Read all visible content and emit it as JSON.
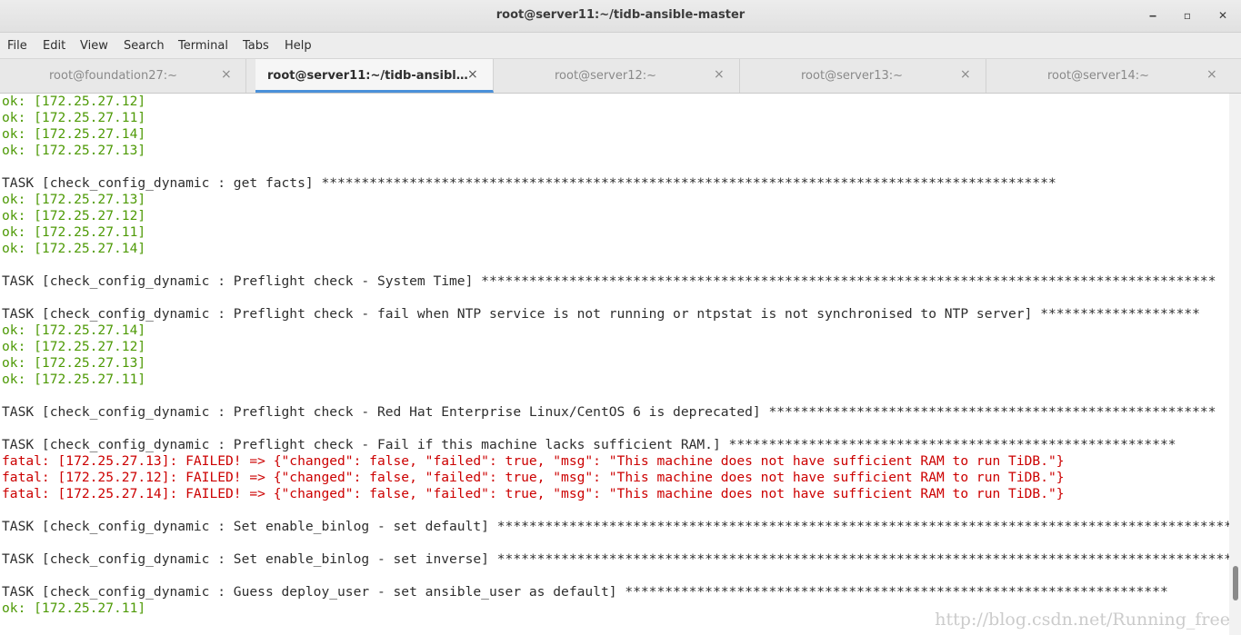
{
  "window": {
    "title": "root@server11:~/tidb-ansible-master",
    "minimize_icon": "minimize-icon",
    "maximize_icon": "maximize-icon",
    "close_icon": "close-icon",
    "minimize_glyph": "‒",
    "maximize_glyph": "▫",
    "close_glyph": "✕"
  },
  "menu": {
    "file": "File",
    "edit": "Edit",
    "view": "View",
    "search": "Search",
    "terminal": "Terminal",
    "tabs": "Tabs",
    "help": "Help"
  },
  "tabs": [
    {
      "label": "root@foundation27:~",
      "close": "×",
      "active": false
    },
    {
      "label": "root@server11:~/tidb-ansibl…",
      "close": "×",
      "active": true
    },
    {
      "label": "root@server12:~",
      "close": "×",
      "active": false
    },
    {
      "label": "root@server13:~",
      "close": "×",
      "active": false
    },
    {
      "label": "root@server14:~",
      "close": "×",
      "active": false
    }
  ],
  "colors": {
    "ok": "#4e9a06",
    "fatal": "#cc0000",
    "text": "#2e2e2e",
    "active_tab_underline": "#4a90d9"
  },
  "terminal": {
    "lines": [
      {
        "type": "ok",
        "text": "ok: [172.25.27.12]"
      },
      {
        "type": "ok",
        "text": "ok: [172.25.27.11]"
      },
      {
        "type": "ok",
        "text": "ok: [172.25.27.14]"
      },
      {
        "type": "ok",
        "text": "ok: [172.25.27.13]"
      },
      {
        "type": "blank",
        "text": ""
      },
      {
        "type": "task",
        "text": "TASK [check_config_dynamic : get facts] ********************************************************************************************"
      },
      {
        "type": "ok",
        "text": "ok: [172.25.27.13]"
      },
      {
        "type": "ok",
        "text": "ok: [172.25.27.12]"
      },
      {
        "type": "ok",
        "text": "ok: [172.25.27.11]"
      },
      {
        "type": "ok",
        "text": "ok: [172.25.27.14]"
      },
      {
        "type": "blank",
        "text": ""
      },
      {
        "type": "task",
        "text": "TASK [check_config_dynamic : Preflight check - System Time] ********************************************************************************************"
      },
      {
        "type": "blank",
        "text": ""
      },
      {
        "type": "task",
        "text": "TASK [check_config_dynamic : Preflight check - fail when NTP service is not running or ntpstat is not synchronised to NTP server] ********************"
      },
      {
        "type": "ok",
        "text": "ok: [172.25.27.14]"
      },
      {
        "type": "ok",
        "text": "ok: [172.25.27.12]"
      },
      {
        "type": "ok",
        "text": "ok: [172.25.27.13]"
      },
      {
        "type": "ok",
        "text": "ok: [172.25.27.11]"
      },
      {
        "type": "blank",
        "text": ""
      },
      {
        "type": "task",
        "text": "TASK [check_config_dynamic : Preflight check - Red Hat Enterprise Linux/CentOS 6 is deprecated] ********************************************************"
      },
      {
        "type": "blank",
        "text": ""
      },
      {
        "type": "task",
        "text": "TASK [check_config_dynamic : Preflight check - Fail if this machine lacks sufficient RAM.] ********************************************************"
      },
      {
        "type": "fatal",
        "text": "fatal: [172.25.27.13]: FAILED! => {\"changed\": false, \"failed\": true, \"msg\": \"This machine does not have sufficient RAM to run TiDB.\"}"
      },
      {
        "type": "fatal",
        "text": "fatal: [172.25.27.12]: FAILED! => {\"changed\": false, \"failed\": true, \"msg\": \"This machine does not have sufficient RAM to run TiDB.\"}"
      },
      {
        "type": "fatal",
        "text": "fatal: [172.25.27.14]: FAILED! => {\"changed\": false, \"failed\": true, \"msg\": \"This machine does not have sufficient RAM to run TiDB.\"}"
      },
      {
        "type": "blank",
        "text": ""
      },
      {
        "type": "task",
        "text": "TASK [check_config_dynamic : Set enable_binlog - set default] ********************************************************************************************"
      },
      {
        "type": "blank",
        "text": ""
      },
      {
        "type": "task",
        "text": "TASK [check_config_dynamic : Set enable_binlog - set inverse] ********************************************************************************************"
      },
      {
        "type": "blank",
        "text": ""
      },
      {
        "type": "task",
        "text": "TASK [check_config_dynamic : Guess deploy_user - set ansible_user as default] ********************************************************************"
      },
      {
        "type": "ok",
        "text": "ok: [172.25.27.11]"
      }
    ]
  },
  "watermark": "http://blog.csdn.net/Running_free"
}
